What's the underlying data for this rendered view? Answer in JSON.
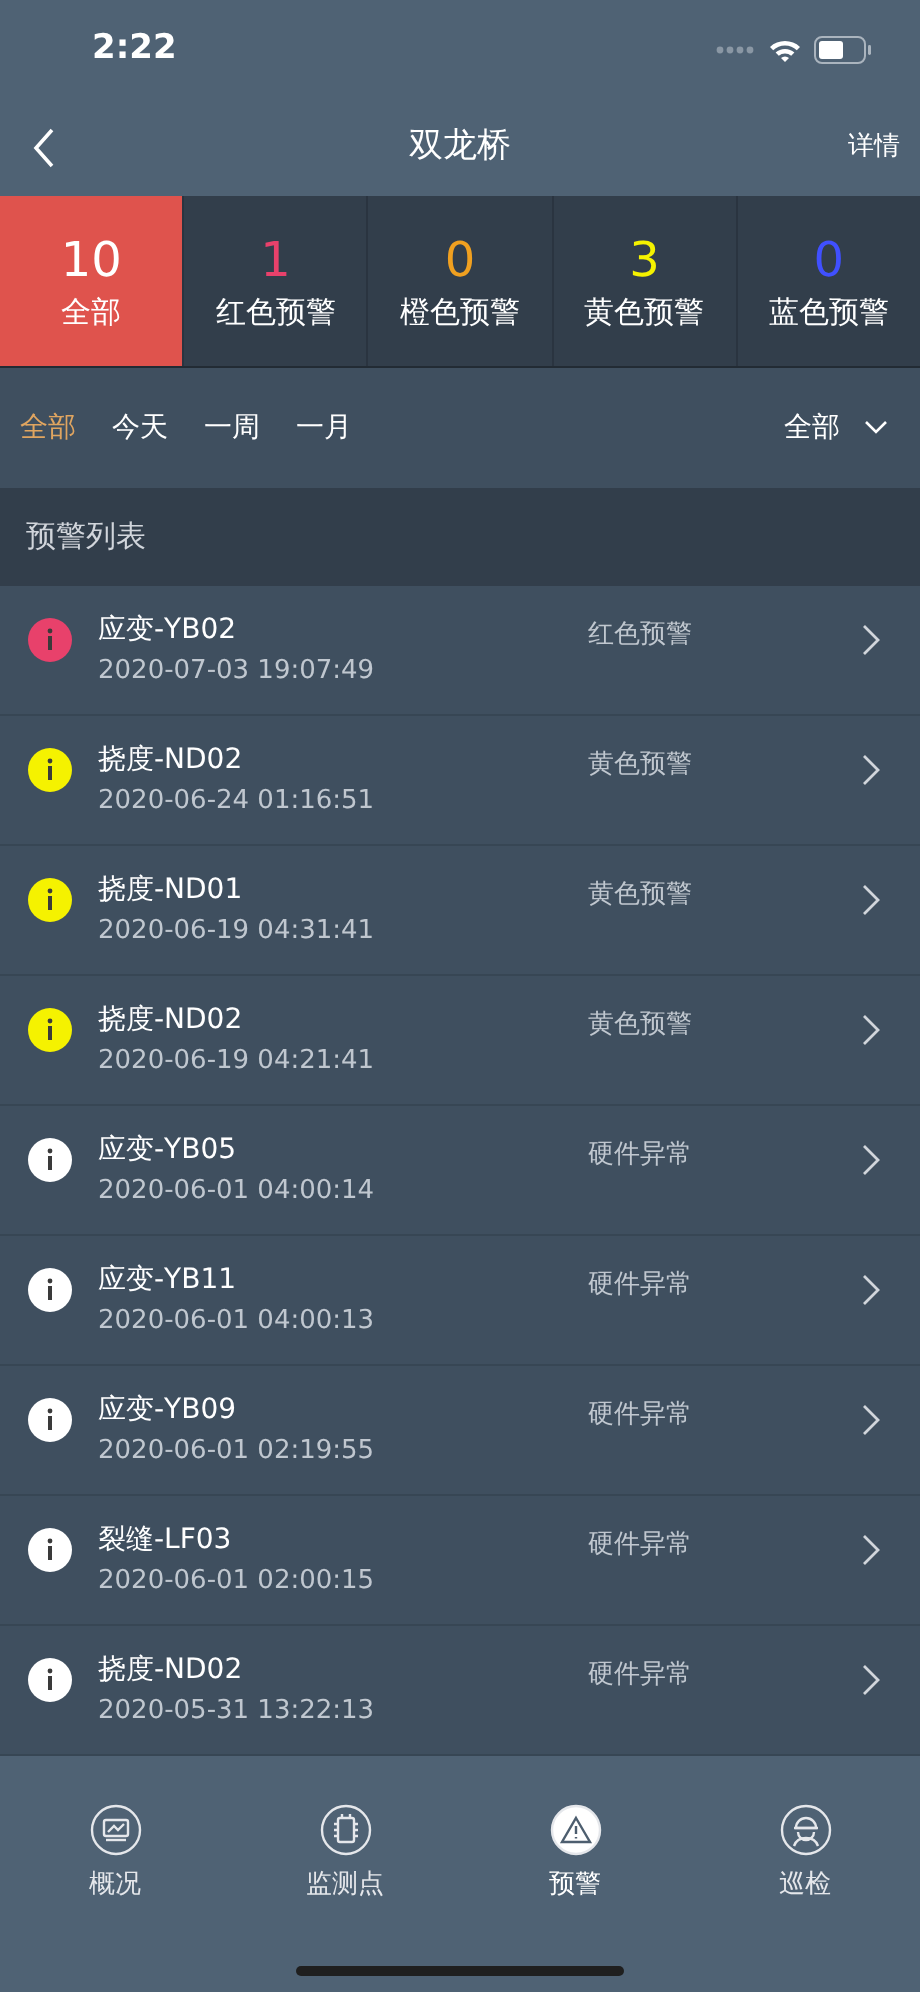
{
  "status_bar": {
    "time": "2:22"
  },
  "nav": {
    "title": "双龙桥",
    "action": "详情"
  },
  "stats": [
    {
      "count": "10",
      "label": "全部",
      "color": "#ffffff",
      "selected": true
    },
    {
      "count": "1",
      "label": "红色预警",
      "color": "#e8416b",
      "selected": false
    },
    {
      "count": "0",
      "label": "橙色预警",
      "color": "#f0a020",
      "selected": false
    },
    {
      "count": "3",
      "label": "黄色预警",
      "color": "#f5f200",
      "selected": false
    },
    {
      "count": "0",
      "label": "蓝色预警",
      "color": "#4050ff",
      "selected": false
    }
  ],
  "filters": [
    {
      "label": "全部",
      "selected": true
    },
    {
      "label": "今天",
      "selected": false
    },
    {
      "label": "一周",
      "selected": false
    },
    {
      "label": "一月",
      "selected": false
    }
  ],
  "type_dropdown": {
    "value": "全部"
  },
  "list_header": "预警列表",
  "alerts": [
    {
      "name": "应变-YB02",
      "time": "2020-07-03 19:07:49",
      "level": "红色预警",
      "color": "#e8416b"
    },
    {
      "name": "挠度-ND02",
      "time": "2020-06-24 01:16:51",
      "level": "黄色预警",
      "color": "#f5f200"
    },
    {
      "name": "挠度-ND01",
      "time": "2020-06-19 04:31:41",
      "level": "黄色预警",
      "color": "#f5f200"
    },
    {
      "name": "挠度-ND02",
      "time": "2020-06-19 04:21:41",
      "level": "黄色预警",
      "color": "#f5f200"
    },
    {
      "name": "应变-YB05",
      "time": "2020-06-01 04:00:14",
      "level": "硬件异常",
      "color": "#ffffff"
    },
    {
      "name": "应变-YB11",
      "time": "2020-06-01 04:00:13",
      "level": "硬件异常",
      "color": "#ffffff"
    },
    {
      "name": "应变-YB09",
      "time": "2020-06-01 02:19:55",
      "level": "硬件异常",
      "color": "#ffffff"
    },
    {
      "name": "裂缝-LF03",
      "time": "2020-06-01 02:00:15",
      "level": "硬件异常",
      "color": "#ffffff"
    },
    {
      "name": "挠度-ND02",
      "time": "2020-05-31 13:22:13",
      "level": "硬件异常",
      "color": "#ffffff"
    }
  ],
  "tab_bar": [
    {
      "kind": "overview",
      "label": "概况",
      "selected": false
    },
    {
      "kind": "points",
      "label": "监测点",
      "selected": false
    },
    {
      "kind": "warning",
      "label": "预警",
      "selected": true
    },
    {
      "kind": "patrol",
      "label": "巡检",
      "selected": false
    }
  ]
}
